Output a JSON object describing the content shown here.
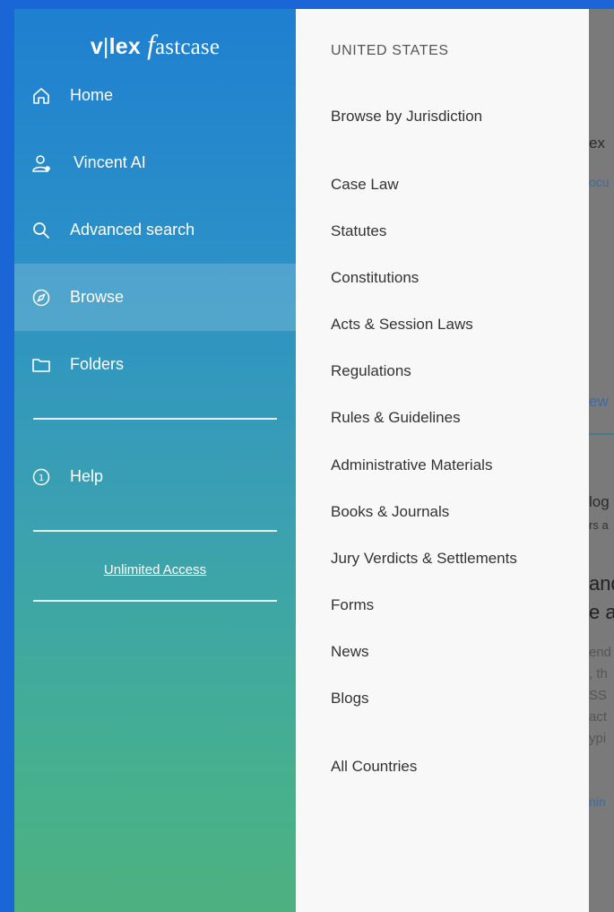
{
  "sidebar": {
    "logo": {
      "left": "v",
      "sep": "|",
      "brand": "lex",
      "f": "f",
      "rest": "astcase"
    },
    "nav": [
      {
        "label": "Home",
        "icon": "home-icon"
      },
      {
        "label": "Vincent AI",
        "icon": "user-icon"
      },
      {
        "label": "Advanced search",
        "icon": "search-icon"
      },
      {
        "label": "Browse",
        "icon": "compass-icon",
        "active": true
      },
      {
        "label": "Folders",
        "icon": "folder-icon"
      }
    ],
    "help": {
      "label": "Help",
      "icon": "help-icon"
    },
    "unlimited_access": "Unlimited Access"
  },
  "menu": {
    "country": "UNITED STATES",
    "items": [
      "Browse by Jurisdiction",
      "Case Law",
      "Statutes",
      "Constitutions",
      "Acts & Session Laws",
      "Regulations",
      "Rules & Guidelines",
      "Administrative Materials",
      "Books & Journals",
      "Jury Verdicts & Settlements",
      "Forms",
      "News",
      "Blogs",
      "All Countries"
    ]
  },
  "background_fragments": {
    "a": "ex",
    "b": "ocu",
    "c": "ew",
    "d": "log",
    "e": "rs a",
    "f": "and",
    "g": "e a",
    "h": "end",
    "i": ", th",
    "j": "SS",
    "k": "act",
    "l": "ypi",
    "m": "nin"
  },
  "colors": {
    "frame": "#1a66d6",
    "menu_bg": "#f8f8f8",
    "menu_text": "#333333"
  }
}
